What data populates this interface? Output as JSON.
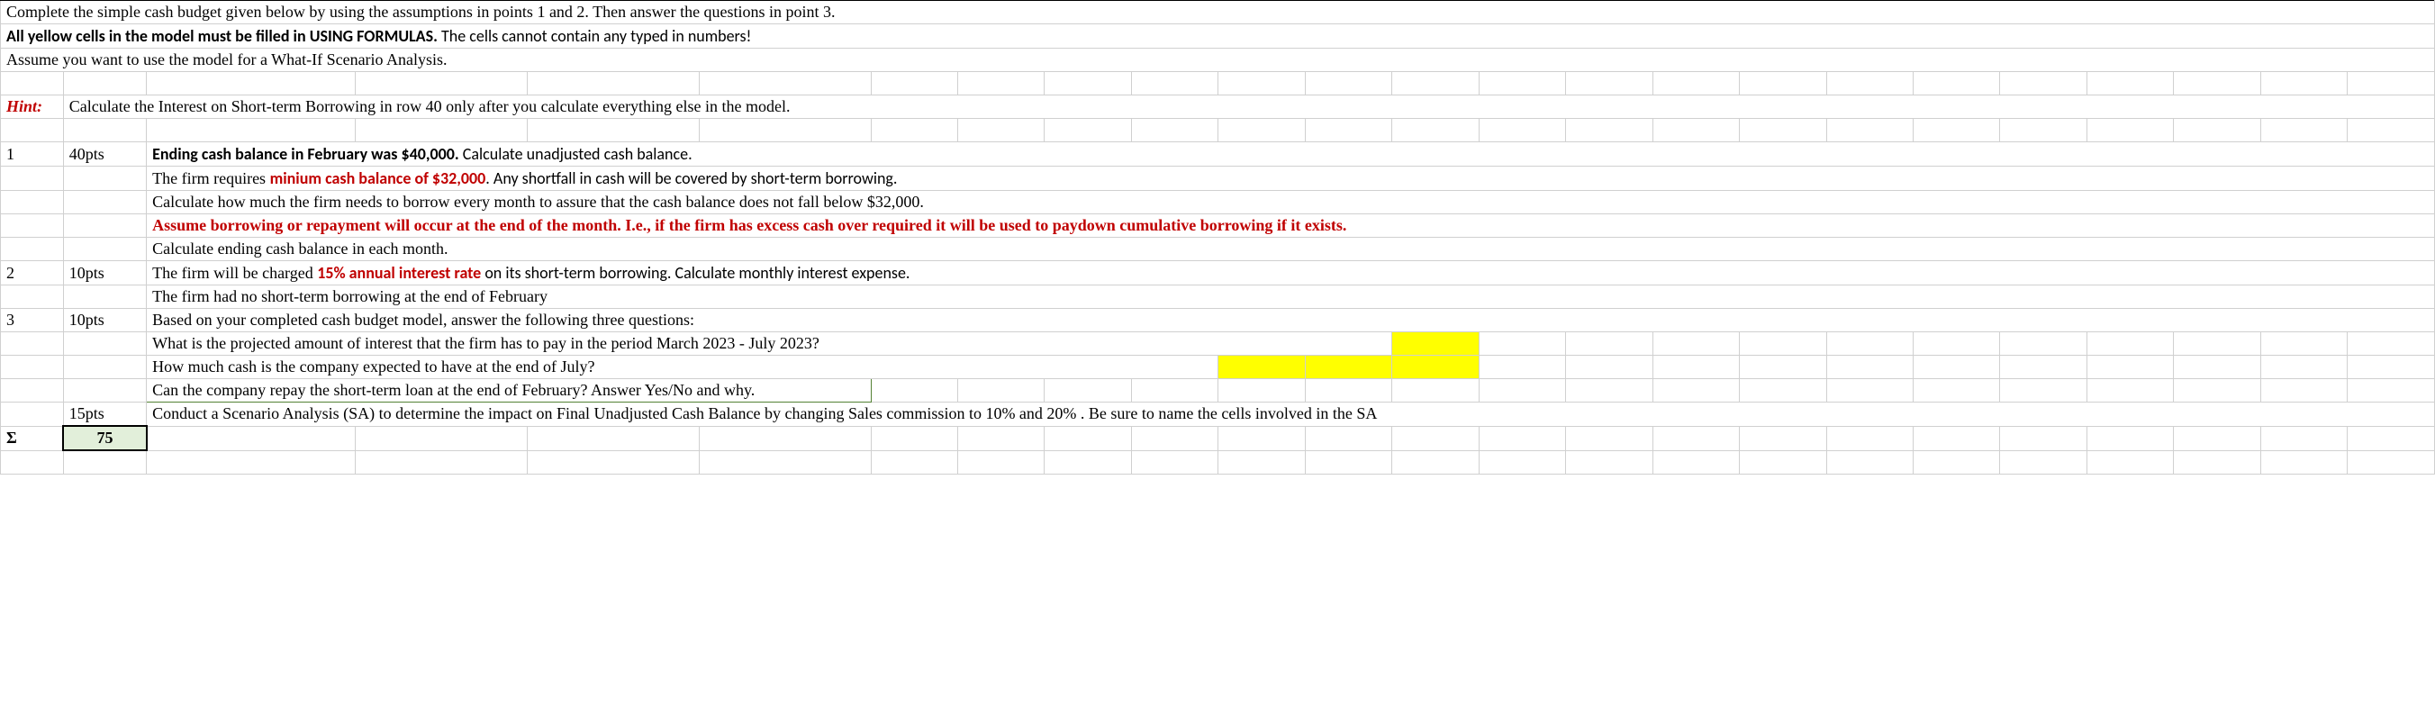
{
  "intro": {
    "line1": "Complete the simple cash budget given below by using the assumptions in points 1 and 2. Then answer the questions in point 3.",
    "line2a": "All yellow cells in the model must be filled in USING FORMULAS.",
    "line2b": " The cells cannot contain any typed in numbers!",
    "line3": "Assume you want to use the model for a What-If Scenario Analysis."
  },
  "hint": {
    "label": "Hint:",
    "text": "Calculate the Interest on Short-term Borrowing in row 40 only after you calculate everything else in the model."
  },
  "items": {
    "n1": "1",
    "p1": "40pts",
    "r1a_bold": "Ending cash balance in February was $40,000.",
    "r1a_rest": " Calculate unadjusted cash balance.",
    "r1b_pre": "The firm requires ",
    "r1b_red": "minium cash balance of $32,000",
    "r1b_post": ". Any shortfall in cash will be covered by short-term borrowing.",
    "r1c": "Calculate how much the firm needs to borrow every month to assure that the cash balance does not fall below $32,000.",
    "r1d": "Assume  borrowing or repayment will occur at the end of the month.  I.e., if the firm has excess cash over required it will be used to paydown cumulative borrowing if it exists.",
    "r1e": "Calculate ending cash balance in each month.",
    "n2": "2",
    "p2": "10pts",
    "r2a_pre": "The firm will be charged ",
    "r2a_red": "15% annual interest rate",
    "r2a_post": " on its short-term borrowing. Calculate monthly interest expense.",
    "r2b": "The firm had no short-term borrowing at the end of February",
    "n3": "3",
    "p3": "10pts",
    "r3a": "Based on your completed cash budget model, answer the following three questions:",
    "r3b": "What is the projected amount of interest that the firm has to pay in the period March 2023 - July 2023?",
    "r3c": "How much cash is the company expected to have at the end of July?",
    "r3d": "Can the company repay the short-term loan at the end of February? Answer Yes/No and why.",
    "p4": "15pts",
    "r4": "Conduct a Scenario Analysis (SA) to determine the impact on Final Unadjusted  Cash Balance by changing Sales commission to 10% and 20% .  Be sure to name the cells involved in the SA"
  },
  "total": {
    "sigma": "Σ",
    "value": "75"
  }
}
